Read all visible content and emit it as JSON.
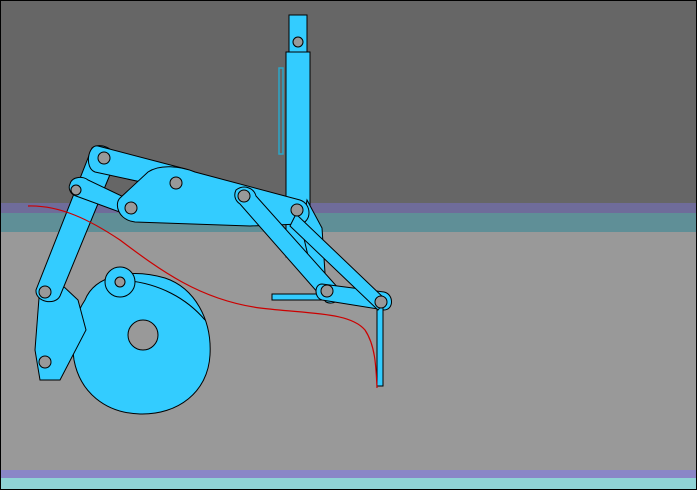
{
  "scene": {
    "description_visible_text": "",
    "colors": {
      "background_upper": "#666666",
      "background_lower": "#999999",
      "rail_top": "#6f6c9a",
      "rail_top_accent": "#5f8f97",
      "rail_bottom": "#8a86c7",
      "rail_bottom_accent": "#8fd3d6",
      "linkage": "#33ccff",
      "outline": "#000000",
      "trace_curve": "#cc0000"
    },
    "elements": {
      "linkage_mechanism": "linkage-mechanism",
      "trace_curve": "foot-trajectory-curve",
      "cam_wheel": "cam-wheel",
      "vertical_slider": "vertical-slider"
    }
  }
}
